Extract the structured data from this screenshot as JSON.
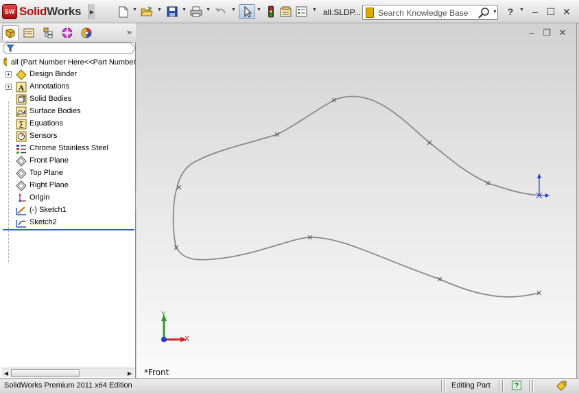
{
  "app": {
    "logo": {
      "brand_a": "Solid",
      "brand_b": "Works",
      "badge": "SW"
    },
    "document_title": "all.SLDP...",
    "colors": {
      "accent_red": "#b01010",
      "selection_blue": "#2b62c5",
      "sketch_gray": "#8a8a8a",
      "triad_y": "#2a9a2a",
      "triad_x": "#d02020",
      "triad_z": "#2040c0"
    }
  },
  "toolbar": {
    "icons": [
      "new-document-icon",
      "open-folder-icon",
      "save-icon",
      "print-icon",
      "undo-icon",
      "select-arrow-icon",
      "rebuild-traffic-light-icon",
      "file-properties-icon",
      "options-icon"
    ],
    "search": {
      "placeholder": "Search Knowledge Base",
      "value": ""
    },
    "help_label": "?"
  },
  "feature_manager": {
    "tabs": [
      "featuremanager-tab",
      "propertymanager-tab",
      "configurationmanager-tab",
      "dimxpert-tab",
      "display-manager-tab"
    ],
    "expand_label": "»",
    "root": {
      "label": "all  (Part Number Here<<Part Number"
    },
    "items": [
      {
        "label": "Design Binder",
        "icon": "design-binder-icon",
        "expandable": true
      },
      {
        "label": "Annotations",
        "icon": "annotations-icon",
        "expandable": true
      },
      {
        "label": "Solid Bodies",
        "icon": "solid-bodies-icon",
        "expandable": false
      },
      {
        "label": "Surface Bodies",
        "icon": "surface-bodies-icon",
        "expandable": false
      },
      {
        "label": "Equations",
        "icon": "equations-icon",
        "expandable": false
      },
      {
        "label": "Sensors",
        "icon": "sensors-icon",
        "expandable": false
      },
      {
        "label": "Chrome Stainless Steel",
        "icon": "material-icon",
        "expandable": false
      },
      {
        "label": "Front Plane",
        "icon": "plane-icon",
        "expandable": false
      },
      {
        "label": "Top Plane",
        "icon": "plane-icon",
        "expandable": false
      },
      {
        "label": "Right Plane",
        "icon": "plane-icon",
        "expandable": false
      },
      {
        "label": "Origin",
        "icon": "origin-icon",
        "expandable": false
      },
      {
        "label": "(-) Sketch1",
        "icon": "sketch-icon",
        "expandable": false
      },
      {
        "label": "Sketch2",
        "icon": "sketch-icon",
        "expandable": false
      }
    ]
  },
  "viewport": {
    "view_label": "*Front",
    "triad": {
      "x_label": "X",
      "y_label": "Y"
    }
  },
  "status": {
    "edition": "SolidWorks Premium 2011 x64 Edition",
    "mode": "Editing Part",
    "help_label": "?"
  }
}
